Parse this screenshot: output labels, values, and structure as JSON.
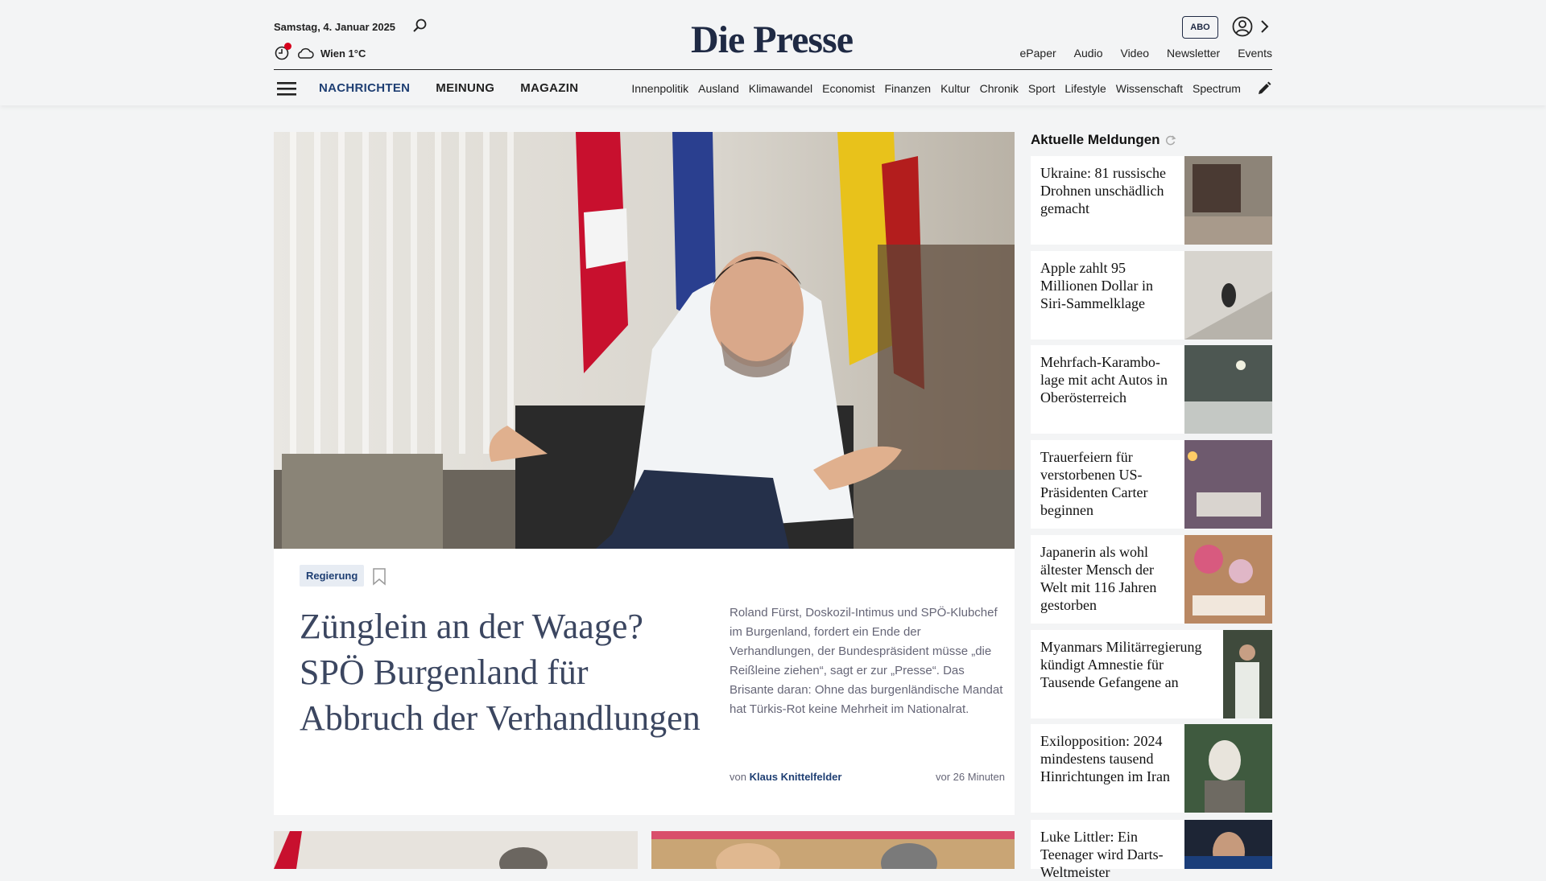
{
  "header": {
    "date": "Samstag, 4. Januar 2025",
    "weather": "Wien 1°C",
    "logo": "Die Presse",
    "abo_label": "ABO",
    "service_links": [
      "ePaper",
      "Audio",
      "Video",
      "Newsletter",
      "Events"
    ]
  },
  "nav": {
    "main": [
      "NACHRICHTEN",
      "MEINUNG",
      "MAGAZIN"
    ],
    "sub": [
      "Innenpolitik",
      "Ausland",
      "Klimawandel",
      "Economist",
      "Finanzen",
      "Kultur",
      "Chronik",
      "Sport",
      "Lifestyle",
      "Wissenschaft",
      "Spectrum"
    ]
  },
  "feature": {
    "tag": "Regierung",
    "headline": "Zünglein an der Waage? SPÖ Burgenland für Abbruch der Verhandlungen",
    "teaser": "Roland Fürst, Doskozil-Intimus und SPÖ-Klubchef im Burgenland, fordert ein Ende der Verhandlungen, der Bundespräsident müsse „die Reißleine ziehen“, sagt er zur „Presse“. Das Brisante daran: Ohne das burgenländische Mandat hat Türkis-Rot keine Mehrheit im Nationalrat.",
    "byline_prefix": "von",
    "author": "Klaus Knittelfelder",
    "time_ago": "vor 26 Minuten"
  },
  "sidebar": {
    "title": "Aktuelle Meldungen",
    "items": [
      {
        "title": "Ukraine: 81 russische Drohnen unschädlich gemacht"
      },
      {
        "title": "Apple zahlt 95 Millionen Dollar in Siri-Sammelklage"
      },
      {
        "title": "Mehrfach-Karambo-lage mit acht Autos in Oberösterreich"
      },
      {
        "title": "Trauerfeiern für verstorbenen US-Präsidenten Carter beginnen"
      },
      {
        "title": "Japanerin als wohl ältester Mensch der Welt mit 116 Jahren gestorben"
      },
      {
        "title": "Myanmars Militärregierung kündigt Amnestie für Tausende Gefangene an"
      },
      {
        "title": "Exilopposition: 2024 mindestens tausend Hinrichtungen im Iran"
      },
      {
        "title": "Luke Littler: Ein Teenager wird Darts-Weltmeister"
      }
    ]
  },
  "colors": {
    "brand_navy": "#1f2a44",
    "accent_blue": "#1f3f73",
    "alert_red": "#d6001c",
    "page_bg": "#f3f4f5"
  },
  "icons": [
    "search-icon",
    "clock-icon",
    "cloud-icon",
    "user-icon",
    "chevron-right-icon",
    "menu-icon",
    "pencil-icon",
    "bookmark-icon",
    "refresh-icon"
  ]
}
